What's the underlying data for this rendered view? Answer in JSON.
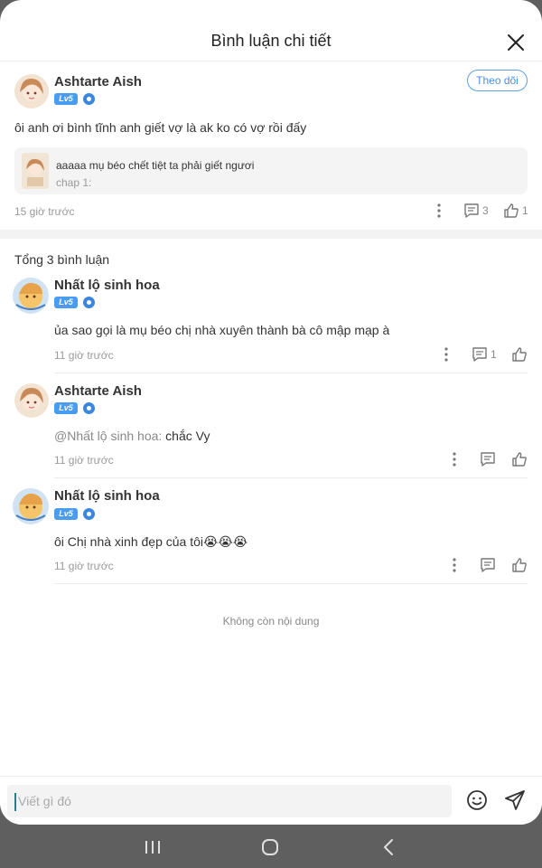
{
  "header": {
    "title": "Bình luận chi tiết"
  },
  "main_comment": {
    "username": "Ashtarte Aish",
    "level": "Lv5",
    "follow_label": "Theo dõi",
    "text": "ôi anh ơi bình tĩnh anh giết vợ là ak ko có vợ rồi đấy",
    "quote": {
      "text": "aaaaa mụ béo chết tiệt ta phải giết ngươi",
      "sub": "chap 1:"
    },
    "time": "15 giờ trước",
    "reply_count": "3",
    "like_count": "1"
  },
  "total_label": "Tổng 3 bình luận",
  "replies": [
    {
      "username": "Nhất lộ sinh hoa",
      "level": "Lv5",
      "mention": "",
      "text": "ủa sao gọi là mụ béo chị nhà xuyên thành bà cô mập mạp à",
      "time": "11 giờ trước",
      "reply_count": "1"
    },
    {
      "username": "Ashtarte Aish",
      "level": "Lv5",
      "mention": "@Nhất lộ sinh hoa:",
      "text": "chắc Vy",
      "time": "11 giờ trước",
      "reply_count": ""
    },
    {
      "username": "Nhất lộ sinh hoa",
      "level": "Lv5",
      "mention": "",
      "text": "ôi Chị nhà xinh đẹp của tôi😭😭😭",
      "time": "11 giờ trước",
      "reply_count": ""
    }
  ],
  "no_more_label": "Không còn nội dung",
  "input": {
    "placeholder": "Viết gì đó"
  },
  "colors": {
    "accent": "#4a90e2",
    "badge": "#4a9cf0"
  }
}
